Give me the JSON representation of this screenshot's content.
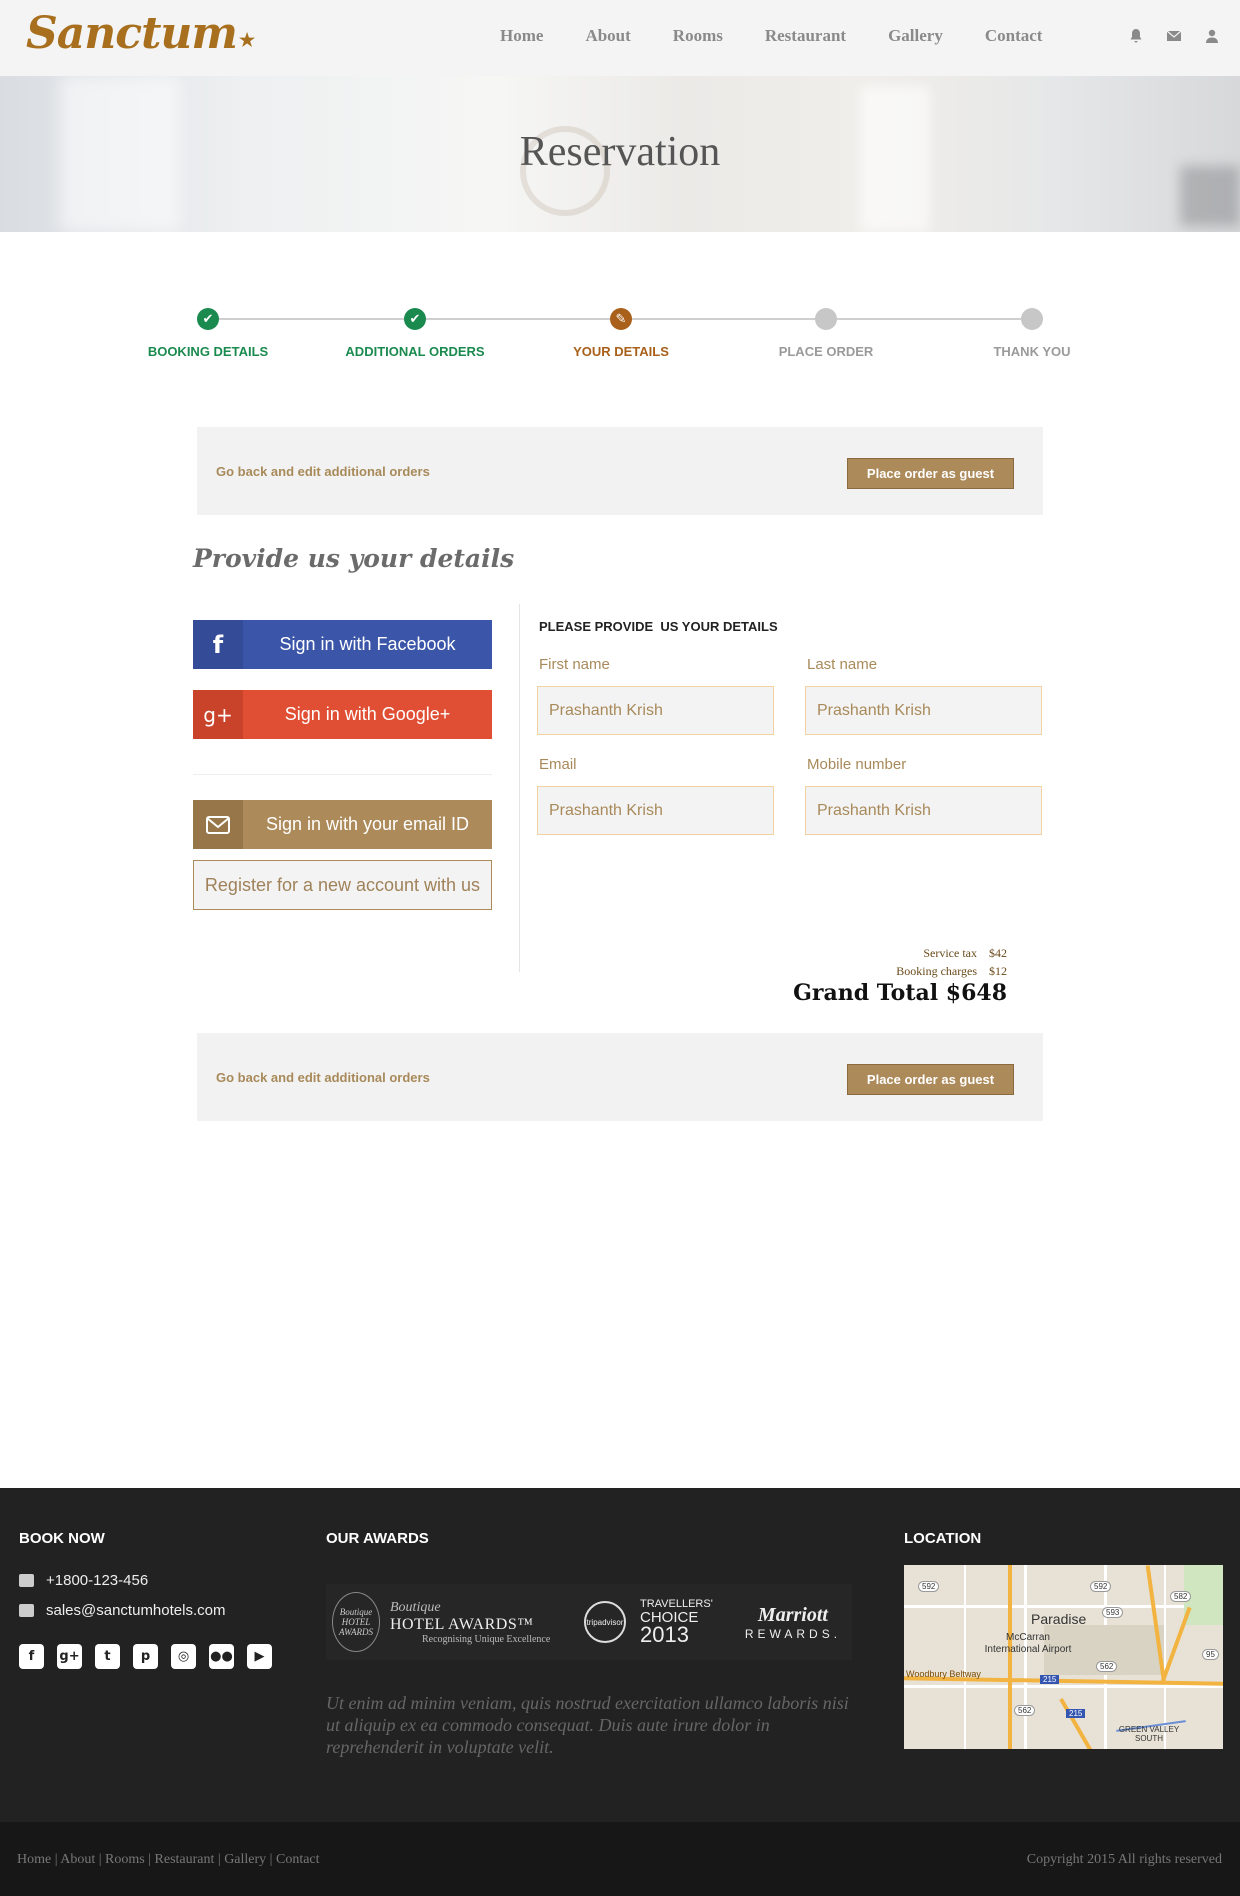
{
  "brand": {
    "logo": "Sanctum",
    "star": "★"
  },
  "nav": {
    "items": [
      "Home",
      "About",
      "Rooms",
      "Restaurant",
      "Gallery",
      "Contact"
    ],
    "icons": [
      "bell-icon",
      "envelope-icon",
      "user-icon"
    ]
  },
  "banner": {
    "title": "Reservation"
  },
  "steps": [
    {
      "label": "BOOKING DETAILS",
      "state": "done"
    },
    {
      "label": "ADDITIONAL ORDERS",
      "state": "done"
    },
    {
      "label": "YOUR DETAILS",
      "state": "current"
    },
    {
      "label": "PLACE ORDER",
      "state": "todo"
    },
    {
      "label": "THANK YOU",
      "state": "todo"
    }
  ],
  "actions": {
    "back_label": "Go back and edit additional orders",
    "guest_label": "Place order as guest"
  },
  "section_title": "Provide us your details",
  "signin": {
    "facebook": "Sign in with Facebook",
    "facebook_icon": "f",
    "google": "Sign in with Google+",
    "google_icon": "g+",
    "email": "Sign in with your email ID",
    "register": "Register for a new account with us"
  },
  "form": {
    "title": "PLEASE PROVIDE  US YOUR DETAILS",
    "first_name": {
      "label": "First name",
      "value": "Prashanth Krish"
    },
    "last_name": {
      "label": "Last name",
      "value": "Prashanth Krish"
    },
    "email": {
      "label": "Email",
      "value": "Prashanth Krish"
    },
    "mobile": {
      "label": "Mobile number",
      "value": "Prashanth Krish"
    }
  },
  "summary": {
    "service_tax_label": "Service tax",
    "service_tax": "$42",
    "booking_label": "Booking charges",
    "booking": "$12",
    "grand_total": "Grand Total $648"
  },
  "footer": {
    "book_now": "BOOK NOW",
    "phone": "+1800-123-456",
    "email": "sales@sanctumhotels.com",
    "social_icons": [
      "facebook-icon",
      "google-plus-icon",
      "twitter-icon",
      "pinterest-icon",
      "instagram-icon",
      "flickr-icon",
      "youtube-icon"
    ],
    "awards_title": "OUR AWARDS",
    "awards": {
      "a1": "Boutique HOTEL AWARDS",
      "a2_script": "Boutique",
      "a2_main": "HOTEL AWARDS™",
      "a2_sub": "Recognising Unique Excellence",
      "a3": "tripadvisor",
      "a4_line1": "TRAVELLERS'",
      "a4_line2": "CHOICE",
      "a4_year": "2013",
      "a5_brand": "Marriott",
      "a5_sub": "REWARDS."
    },
    "lorem": "Ut enim ad minim veniam, quis nostrud exercitation ullamco laboris nisi ut aliquip ex ea commodo consequat. Duis aute irure dolor in reprehenderit in voluptate velit.",
    "location_title": "LOCATION",
    "map": {
      "city": "Paradise",
      "airport": "McCarran International Airport",
      "beltway": "Woodbury Beltway",
      "green_valley": "GREEN VALLEY SOUTH",
      "r592a": "592",
      "r592b": "592",
      "r593": "593",
      "r582": "582",
      "r562a": "562",
      "r562b": "562",
      "r95": "95",
      "r215a": "215",
      "r215b": "215"
    },
    "bottom_links": "Home | About | Rooms | Restaurant | Gallery | Contact",
    "copyright": "Copyright 2015 All rights reserved"
  }
}
